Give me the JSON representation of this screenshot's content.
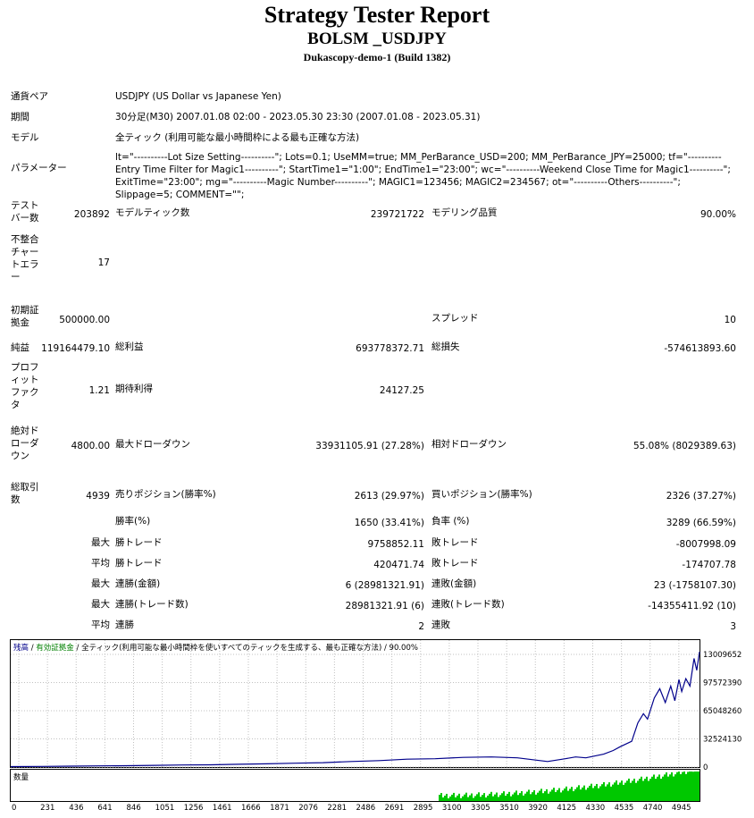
{
  "header": {
    "title": "Strategy Tester Report",
    "subtitle": "BOLSM _USDJPY",
    "server": "Dukascopy-demo-1 (Build 1382)"
  },
  "info": {
    "symbol_label": "通貨ペア",
    "symbol": "USDJPY (US Dollar vs Japanese Yen)",
    "period_label": "期間",
    "period": "30分足(M30) 2007.01.08 02:00 - 2023.05.30 23:30 (2007.01.08 - 2023.05.31)",
    "model_label": "モデル",
    "model": "全ティック (利用可能な最小時間枠による最も正確な方法)",
    "params_label": "パラメーター",
    "params": "lt=\"----------Lot Size Setting----------\"; Lots=0.1; UseMM=true; MM_PerBarance_USD=200; MM_PerBarance_JPY=25000; tf=\"----------Entry Time Filter for Magic1----------\"; StartTime1=\"1:00\"; EndTime1=\"23:00\"; wc=\"----------Weekend Close Time for Magic1----------\"; ExitTime=\"23:00\"; mg=\"----------Magic Number----------\"; MAGIC1=123456; MAGIC2=234567; ot=\"----------Others----------\"; Slippage=5; COMMENT=\"\";"
  },
  "stats": {
    "bars_label": "テストバー数",
    "bars": "203892",
    "ticks_label": "モデルティック数",
    "ticks": "239721722",
    "quality_label": "モデリング品質",
    "quality": "90.00%",
    "mismatch_label": "不整合チャートエラー",
    "mismatch": "17",
    "deposit_label": "初期証拠金",
    "deposit": "500000.00",
    "spread_label": "スプレッド",
    "spread": "10",
    "net_label": "純益",
    "net": "119164479.10",
    "gross_profit_label": "総利益",
    "gross_profit": "693778372.71",
    "gross_loss_label": "総損失",
    "gross_loss": "-574613893.60",
    "pf_label": "プロフィットファクタ",
    "pf": "1.21",
    "expected_label": "期待利得",
    "expected": "24127.25",
    "abs_dd_label": "絶対ドローダウン",
    "abs_dd": "4800.00",
    "max_dd_label": "最大ドローダウン",
    "max_dd": "33931105.91 (27.28%)",
    "rel_dd_label": "相対ドローダウン",
    "rel_dd": "55.08% (8029389.63)",
    "trades_label": "総取引数",
    "trades": "4939",
    "short_label": "売りポジション(勝率%)",
    "short": "2613 (29.97%)",
    "long_label": "買いポジション(勝率%)",
    "long": "2326 (37.27%)",
    "win_rate_label": "勝率(%)",
    "win_rate": "1650 (33.41%)",
    "loss_rate_label": "負率 (%)",
    "loss_rate": "3289 (66.59%)",
    "max_win_prefix": "最大",
    "max_win_label": "勝トレード",
    "max_win": "9758852.11",
    "max_loss_label": "敗トレード",
    "max_loss": "-8007998.09",
    "avg_win_prefix": "平均",
    "avg_win_label": "勝トレード",
    "avg_win": "420471.74",
    "avg_loss_label": "敗トレード",
    "avg_loss": "-174707.78",
    "consec_win_money_prefix": "最大",
    "consec_win_money_label": "連勝(金額)",
    "consec_win_money": "6 (28981321.91)",
    "consec_loss_money_label": "連敗(金額)",
    "consec_loss_money": "23 (-1758107.30)",
    "consec_win_count_prefix": "最大",
    "consec_win_count_label": "連勝(トレード数)",
    "consec_win_count": "28981321.91 (6)",
    "consec_loss_count_label": "連敗(トレード数)",
    "consec_loss_count": "-14355411.92 (10)",
    "avg_consec_win_prefix": "平均",
    "avg_consec_win_label": "連勝",
    "avg_consec_win": "2",
    "avg_consec_loss_label": "連敗",
    "avg_consec_loss": "3"
  },
  "chart_data": {
    "type": "line",
    "legend": {
      "balance": "残高",
      "sep1": " / ",
      "equity": "有効証拠金",
      "sep2": " / ",
      "desc": "全ティック(利用可能な最小時間枠を使いすべてのティックを生成する、最も正確な方法) / 90.00%"
    },
    "volume_label": "数量",
    "x_ticks": [
      "0",
      "231",
      "436",
      "641",
      "846",
      "1051",
      "1256",
      "1461",
      "1666",
      "1871",
      "2076",
      "2281",
      "2486",
      "2691",
      "2895",
      "3100",
      "3305",
      "3510",
      "3920",
      "4125",
      "4330",
      "4535",
      "4740",
      "4945"
    ],
    "y_ticks": [
      "13009652",
      "97572390",
      "65048260",
      "32524130",
      "0"
    ],
    "ylim": [
      0,
      130096520
    ],
    "xlim": [
      0,
      5030
    ],
    "series": [
      {
        "values": [
          [
            0,
            500000
          ],
          [
            231,
            700000
          ],
          [
            436,
            1000000
          ],
          [
            641,
            1300000
          ],
          [
            846,
            1500000
          ],
          [
            1051,
            1800000
          ],
          [
            1256,
            2200000
          ],
          [
            1461,
            2400000
          ],
          [
            1666,
            3000000
          ],
          [
            1871,
            3500000
          ],
          [
            2076,
            4200000
          ],
          [
            2281,
            4800000
          ],
          [
            2486,
            6000000
          ],
          [
            2691,
            7000000
          ],
          [
            2895,
            8500000
          ],
          [
            3100,
            9000000
          ],
          [
            3305,
            10500000
          ],
          [
            3510,
            11000000
          ],
          [
            3700,
            10000000
          ],
          [
            3920,
            6000000
          ],
          [
            4050,
            9000000
          ],
          [
            4125,
            11000000
          ],
          [
            4200,
            10000000
          ],
          [
            4330,
            14000000
          ],
          [
            4400,
            18000000
          ],
          [
            4450,
            22000000
          ],
          [
            4535,
            28000000
          ],
          [
            4580,
            48000000
          ],
          [
            4620,
            58000000
          ],
          [
            4650,
            52000000
          ],
          [
            4700,
            75000000
          ],
          [
            4740,
            85000000
          ],
          [
            4780,
            70000000
          ],
          [
            4820,
            88000000
          ],
          [
            4850,
            72000000
          ],
          [
            4880,
            95000000
          ],
          [
            4900,
            82000000
          ],
          [
            4930,
            96000000
          ],
          [
            4960,
            88000000
          ],
          [
            4990,
            118000000
          ],
          [
            5010,
            105000000
          ],
          [
            5030,
            125000000
          ]
        ]
      }
    ],
    "colors": {
      "balance": "#00008b",
      "volume": "#00c800",
      "grid": "#c0c0c0",
      "legend_equity": "#008000"
    }
  }
}
